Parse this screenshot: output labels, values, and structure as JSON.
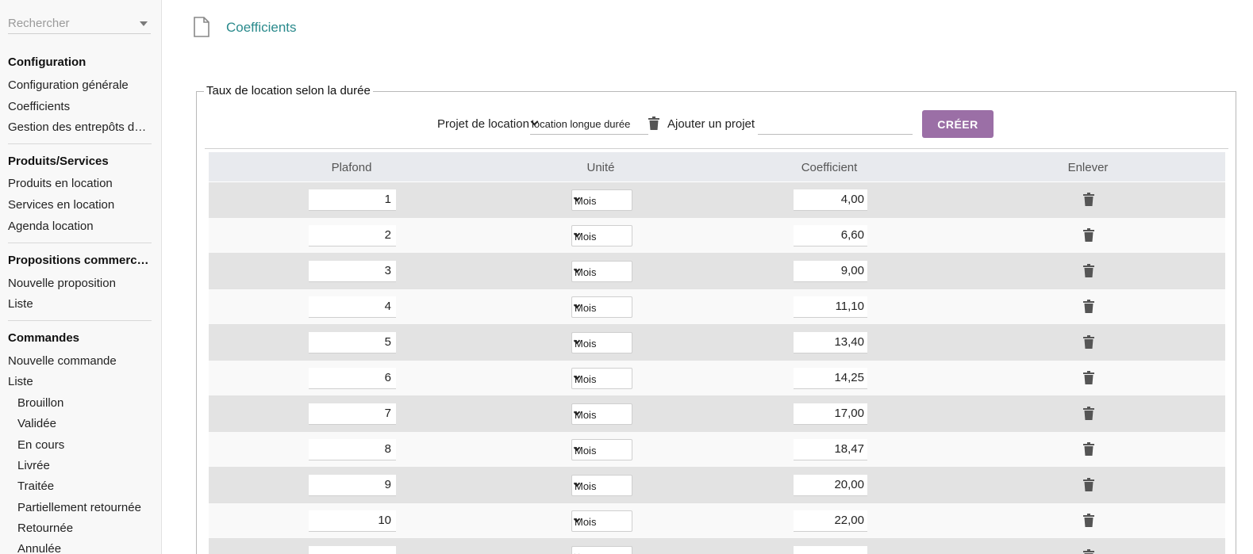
{
  "sidebar": {
    "search_placeholder": "Rechercher",
    "sections": [
      {
        "title": "Configuration",
        "items": [
          "Configuration générale",
          "Coefficients",
          "Gestion des entrepôts de location"
        ]
      },
      {
        "title": "Produits/Services",
        "items": [
          "Produits en location",
          "Services en location",
          "Agenda location"
        ]
      },
      {
        "title": "Propositions commerciales",
        "items": [
          "Nouvelle proposition",
          "Liste"
        ]
      },
      {
        "title": "Commandes",
        "items": [
          "Nouvelle commande",
          "Liste"
        ],
        "subitems": [
          "Brouillon",
          "Validée",
          "En cours",
          "Livrée",
          "Traitée",
          "Partiellement retournée",
          "Retournée",
          "Annulée"
        ]
      }
    ]
  },
  "page": {
    "title": "Coefficients",
    "icon": "file-icon"
  },
  "fieldset": {
    "legend": "Taux de location selon la durée"
  },
  "toolbar": {
    "project_label": "Projet de location",
    "project_value": "location longue durée",
    "add_label": "Ajouter un projet",
    "add_value": "",
    "create_button": "CRÉER"
  },
  "colors": {
    "accent": "#9b6fa6",
    "link": "#2a8a8c"
  },
  "table": {
    "headers": {
      "plafond": "Plafond",
      "unite": "Unité",
      "coefficient": "Coefficient",
      "enlever": "Enlever"
    },
    "rows": [
      {
        "plafond": "1",
        "unite": "Mois",
        "coefficient": "4,00"
      },
      {
        "plafond": "2",
        "unite": "Mois",
        "coefficient": "6,60"
      },
      {
        "plafond": "3",
        "unite": "Mois",
        "coefficient": "9,00"
      },
      {
        "plafond": "4",
        "unite": "Mois",
        "coefficient": "11,10"
      },
      {
        "plafond": "5",
        "unite": "Mois",
        "coefficient": "13,40"
      },
      {
        "plafond": "6",
        "unite": "Mois",
        "coefficient": "14,25"
      },
      {
        "plafond": "7",
        "unite": "Mois",
        "coefficient": "17,00"
      },
      {
        "plafond": "8",
        "unite": "Mois",
        "coefficient": "18,47"
      },
      {
        "plafond": "9",
        "unite": "Mois",
        "coefficient": "20,00"
      },
      {
        "plafond": "10",
        "unite": "Mois",
        "coefficient": "22,00"
      },
      {
        "plafond": "",
        "unite": "",
        "coefficient": ""
      }
    ]
  }
}
